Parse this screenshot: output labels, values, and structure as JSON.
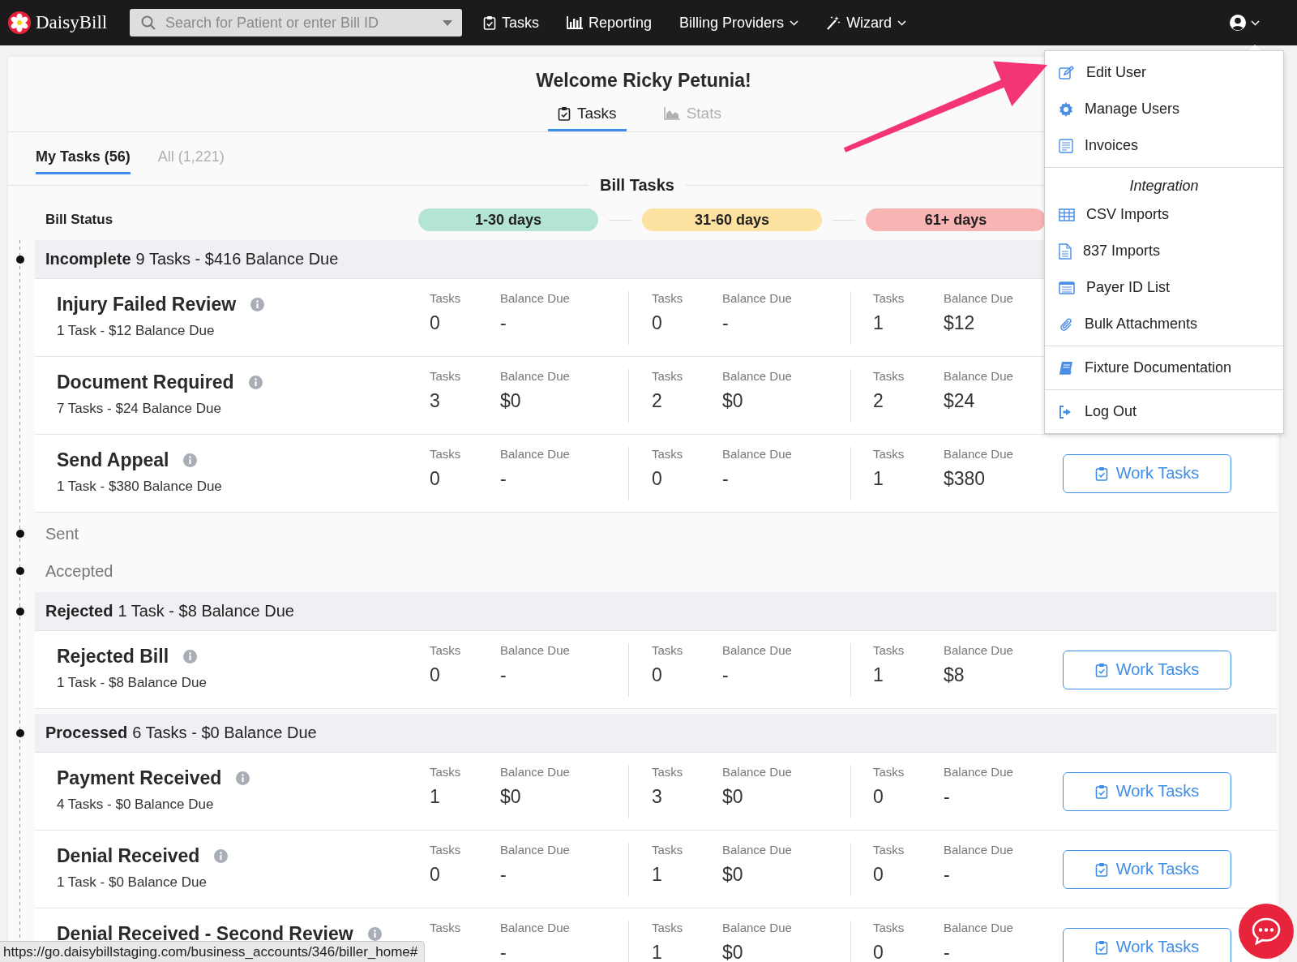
{
  "nav": {
    "logo": "DaisyBill",
    "search": {
      "placeholder": "Search for Patient or enter Bill ID"
    },
    "links": [
      {
        "label": "Tasks",
        "dropdown": false
      },
      {
        "label": "Reporting",
        "dropdown": false
      },
      {
        "label": "Billing Providers",
        "dropdown": true
      },
      {
        "label": "Wizard",
        "dropdown": true
      }
    ]
  },
  "welcome": "Welcome Ricky Petunia!",
  "view_tabs": [
    {
      "label": "Tasks",
      "selected": true
    },
    {
      "label": "Stats",
      "selected": false
    }
  ],
  "task_tabs": [
    {
      "label": "My Tasks (56)",
      "selected": true
    },
    {
      "label": "All (1,221)",
      "selected": false
    }
  ],
  "section_title": "Bill Tasks",
  "bill_status_label": "Bill Status",
  "age_pills": [
    {
      "label": "1-30 days",
      "color": "#b4e4d2"
    },
    {
      "label": "31-60 days",
      "color": "#fde1a0"
    },
    {
      "label": "61+ days",
      "color": "#f8b3b3"
    }
  ],
  "groups": [
    {
      "name": "Incomplete",
      "summary": "9 Tasks - $416 Balance Due",
      "tasks": [
        {
          "name": "Injury Failed Review",
          "summary": "1 Task - $12 Balance Due",
          "buckets": [
            {
              "tasks_label": "Tasks",
              "tasks": "0",
              "balance_label": "Balance Due",
              "balance": "-"
            },
            {
              "tasks_label": "Tasks",
              "tasks": "0",
              "balance_label": "Balance Due",
              "balance": "-"
            },
            {
              "tasks_label": "Tasks",
              "tasks": "1",
              "balance_label": "Balance Due",
              "balance": "$12"
            }
          ]
        },
        {
          "name": "Document Required",
          "summary": "7 Tasks - $24 Balance Due",
          "buckets": [
            {
              "tasks_label": "Tasks",
              "tasks": "3",
              "balance_label": "Balance Due",
              "balance": "$0"
            },
            {
              "tasks_label": "Tasks",
              "tasks": "2",
              "balance_label": "Balance Due",
              "balance": "$0"
            },
            {
              "tasks_label": "Tasks",
              "tasks": "2",
              "balance_label": "Balance Due",
              "balance": "$24"
            }
          ]
        },
        {
          "name": "Send Appeal",
          "summary": "1 Task - $380 Balance Due",
          "buckets": [
            {
              "tasks_label": "Tasks",
              "tasks": "0",
              "balance_label": "Balance Due",
              "balance": "-"
            },
            {
              "tasks_label": "Tasks",
              "tasks": "0",
              "balance_label": "Balance Due",
              "balance": "-"
            },
            {
              "tasks_label": "Tasks",
              "tasks": "1",
              "balance_label": "Balance Due",
              "balance": "$380"
            }
          ],
          "button": "Work Tasks"
        }
      ]
    },
    {
      "name": "Sent"
    },
    {
      "name": "Accepted"
    },
    {
      "name": "Rejected",
      "summary": "1 Task - $8 Balance Due",
      "tasks": [
        {
          "name": "Rejected Bill",
          "summary": "1 Task - $8 Balance Due",
          "buckets": [
            {
              "tasks_label": "Tasks",
              "tasks": "0",
              "balance_label": "Balance Due",
              "balance": "-"
            },
            {
              "tasks_label": "Tasks",
              "tasks": "0",
              "balance_label": "Balance Due",
              "balance": "-"
            },
            {
              "tasks_label": "Tasks",
              "tasks": "1",
              "balance_label": "Balance Due",
              "balance": "$8"
            }
          ],
          "button": "Work Tasks"
        }
      ]
    },
    {
      "name": "Processed",
      "summary": "6 Tasks - $0 Balance Due",
      "tasks": [
        {
          "name": "Payment Received",
          "summary": "4 Tasks - $0 Balance Due",
          "buckets": [
            {
              "tasks_label": "Tasks",
              "tasks": "1",
              "balance_label": "Balance Due",
              "balance": "$0"
            },
            {
              "tasks_label": "Tasks",
              "tasks": "3",
              "balance_label": "Balance Due",
              "balance": "$0"
            },
            {
              "tasks_label": "Tasks",
              "tasks": "0",
              "balance_label": "Balance Due",
              "balance": "-"
            }
          ],
          "button": "Work Tasks"
        },
        {
          "name": "Denial Received",
          "summary": "1 Task - $0 Balance Due",
          "buckets": [
            {
              "tasks_label": "Tasks",
              "tasks": "0",
              "balance_label": "Balance Due",
              "balance": "-"
            },
            {
              "tasks_label": "Tasks",
              "tasks": "1",
              "balance_label": "Balance Due",
              "balance": "$0"
            },
            {
              "tasks_label": "Tasks",
              "tasks": "0",
              "balance_label": "Balance Due",
              "balance": "-"
            }
          ],
          "button": "Work Tasks"
        },
        {
          "name": "Denial Received - Second Review",
          "buckets": [
            {
              "tasks_label": "Tasks",
              "balance_label": "Balance Due",
              "balance": "-"
            },
            {
              "tasks_label": "Tasks",
              "tasks": "1",
              "balance_label": "Balance Due",
              "balance": "$0"
            },
            {
              "tasks_label": "Tasks",
              "tasks": "0",
              "balance_label": "Balance Due",
              "balance": "-"
            }
          ],
          "button": "Work Tasks"
        }
      ]
    }
  ],
  "user_menu": {
    "open": true,
    "sections": [
      {
        "items": [
          {
            "label": "Edit User"
          },
          {
            "label": "Manage Users"
          },
          {
            "label": "Invoices"
          }
        ]
      },
      {
        "heading": "Integration",
        "items": [
          {
            "label": "CSV Imports"
          },
          {
            "label": "837 Imports"
          },
          {
            "label": "Payer ID List"
          },
          {
            "label": "Bulk Attachments"
          }
        ]
      },
      {
        "items": [
          {
            "label": "Fixture Documentation"
          }
        ]
      },
      {
        "items": [
          {
            "label": "Log Out"
          }
        ]
      }
    ]
  },
  "status_bar": {
    "url": "https://go.daisybillstaging.com/business_accounts/346/biller_home#"
  }
}
